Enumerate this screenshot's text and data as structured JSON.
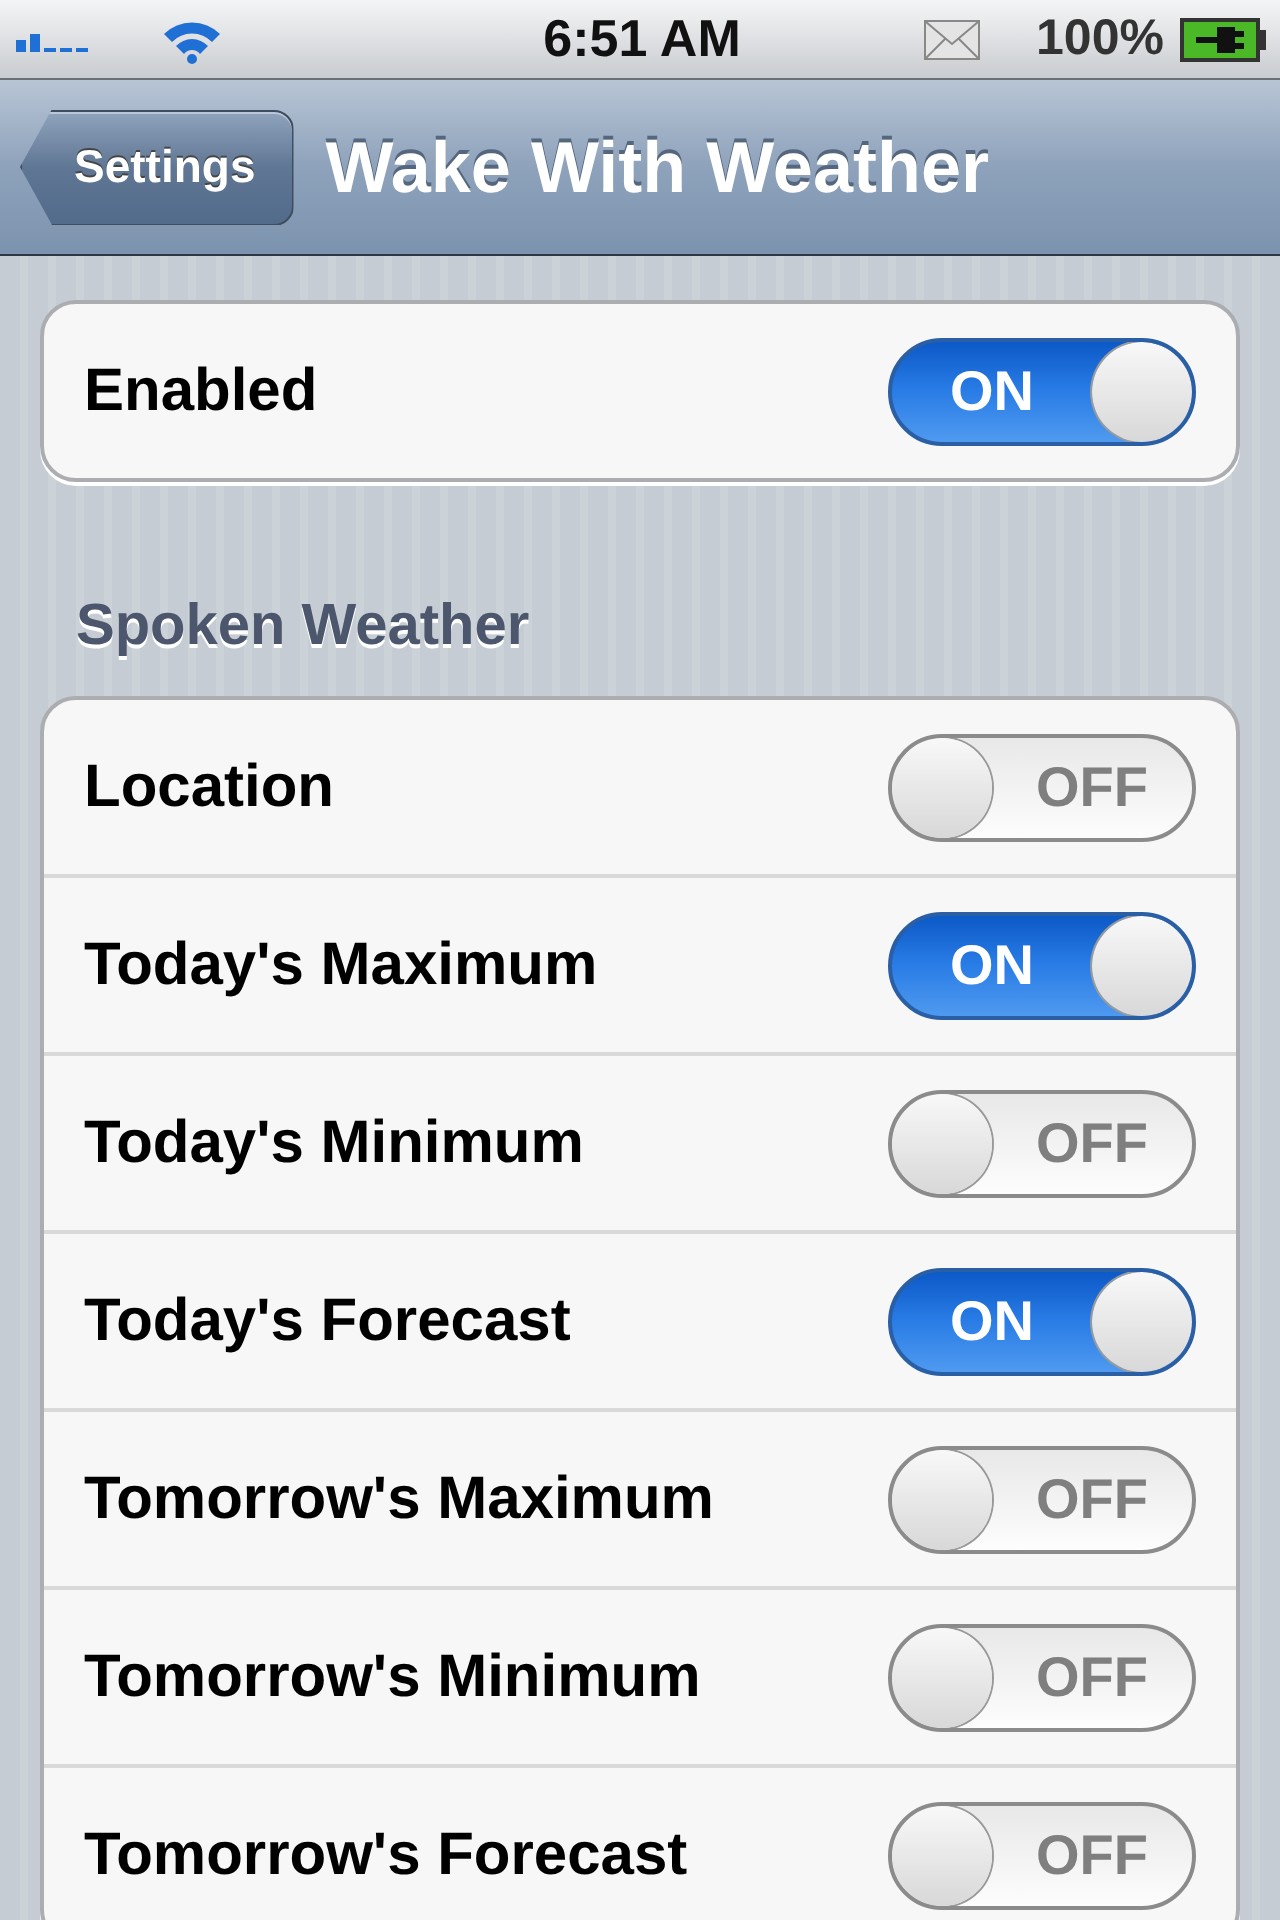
{
  "status_bar": {
    "time": "6:51 AM",
    "battery": "100%"
  },
  "nav_bar": {
    "back": "Settings",
    "title": "Wake With Weather"
  },
  "groups": [
    {
      "rows": [
        {
          "label": "Enabled",
          "on": true,
          "switch_text": "ON"
        }
      ]
    },
    {
      "header": "Spoken Weather",
      "rows": [
        {
          "label": "Location",
          "on": false,
          "switch_text": "OFF"
        },
        {
          "label": "Today's Maximum",
          "on": true,
          "switch_text": "ON"
        },
        {
          "label": "Today's Minimum",
          "on": false,
          "switch_text": "OFF"
        },
        {
          "label": "Today's Forecast",
          "on": true,
          "switch_text": "ON"
        },
        {
          "label": "Tomorrow's Maximum",
          "on": false,
          "switch_text": "OFF"
        },
        {
          "label": "Tomorrow's Minimum",
          "on": false,
          "switch_text": "OFF"
        },
        {
          "label": "Tomorrow's Forecast",
          "on": false,
          "switch_text": "OFF"
        }
      ]
    }
  ]
}
